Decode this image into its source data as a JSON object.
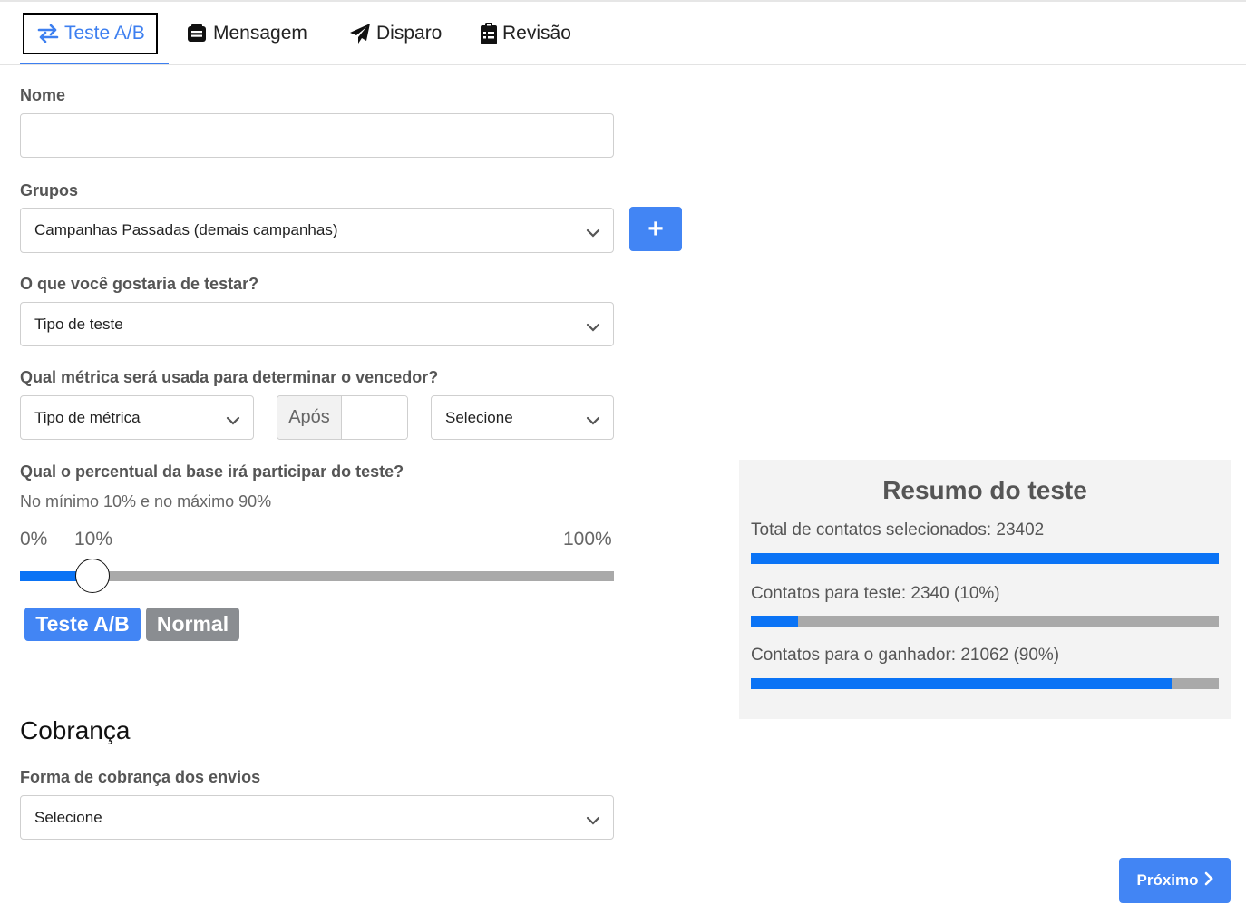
{
  "tabs": [
    {
      "label": "Teste A/B",
      "icon": "swap-arrows-icon",
      "active": true
    },
    {
      "label": "Mensagem",
      "icon": "message-box-icon"
    },
    {
      "label": "Disparo",
      "icon": "paper-plane-icon"
    },
    {
      "label": "Revisão",
      "icon": "clipboard-check-icon"
    }
  ],
  "form": {
    "name_label": "Nome",
    "name_value": "",
    "groups_label": "Grupos",
    "groups_value": "Campanhas Passadas (demais campanhas)",
    "add_group_label": "+",
    "test_label": "O que você gostaria de testar?",
    "test_value": "Tipo de teste",
    "metric_label": "Qual métrica será usada para determinar o vencedor?",
    "metric_value": "Tipo de métrica",
    "after_label": "Após",
    "after_value": "",
    "period_value": "Selecione",
    "percent_label": "Qual o percentual da base irá participar do teste?",
    "percent_hint": "No mínimo 10% e no máximo 90%",
    "slider": {
      "min_label": "0%",
      "current_label": "10%",
      "max_label": "100%",
      "value_percent": 10
    },
    "badge_ab": "Teste A/B",
    "badge_normal": "Normal"
  },
  "billing": {
    "title": "Cobrança",
    "method_label": "Forma de cobrança dos envios",
    "method_value": "Selecione"
  },
  "summary": {
    "title": "Resumo do teste",
    "total_text": "Total de contatos selecionados: 23402",
    "total_fraction": 1.0,
    "test_text": "Contatos para teste: 2340 (10%)",
    "test_fraction": 0.1,
    "winner_text": "Contatos para o ganhador: 21062 (90%)",
    "winner_fraction": 0.9
  },
  "next_label": "Próximo",
  "colors": {
    "accent": "#4285f4",
    "bar": "#0a73f5",
    "badge_gray": "#8a8d91"
  }
}
